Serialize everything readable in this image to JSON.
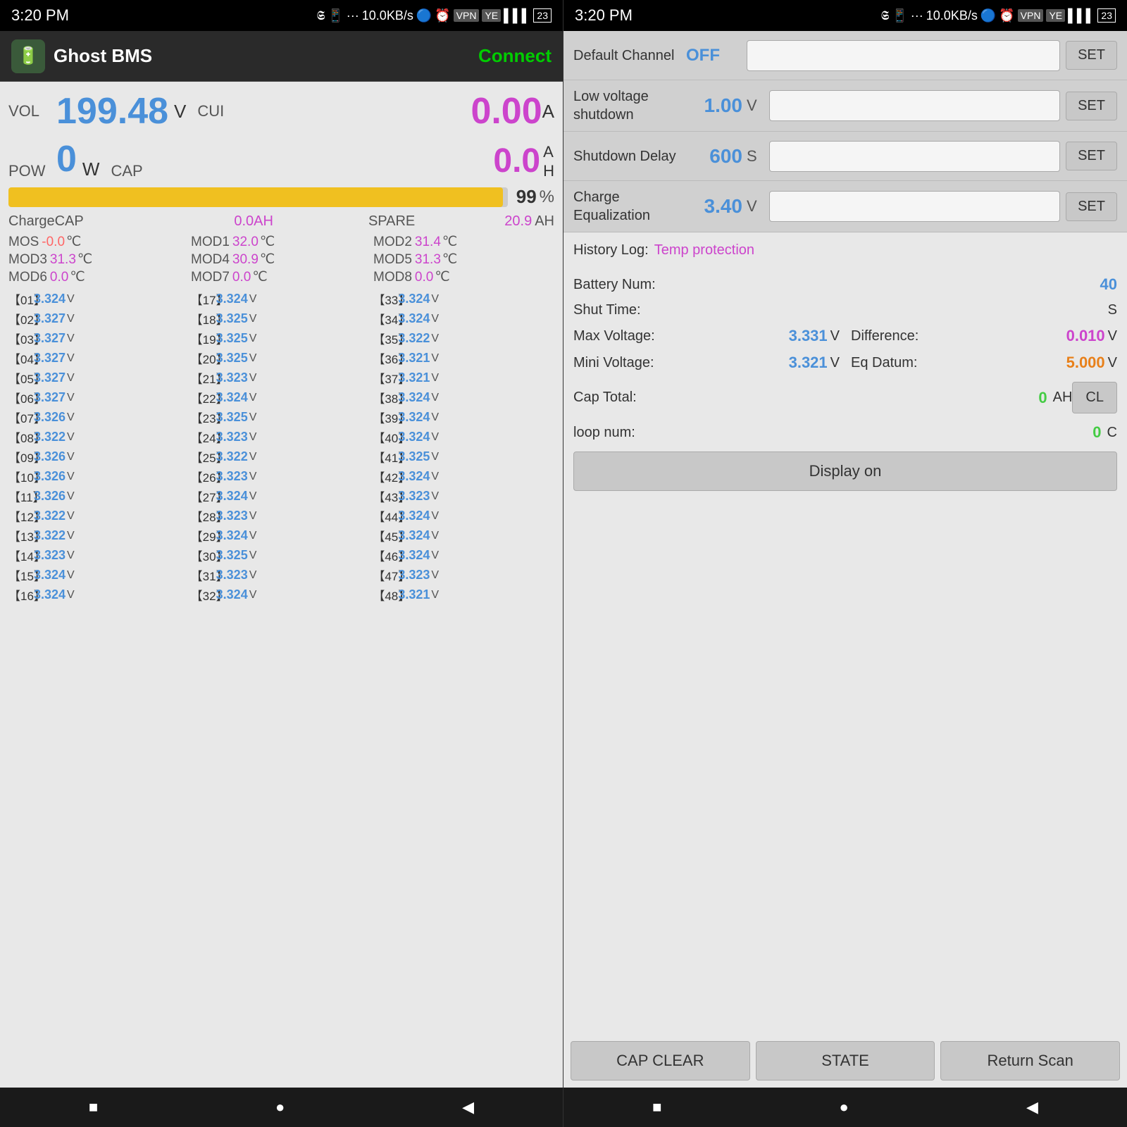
{
  "left": {
    "statusBar": {
      "time": "3:20 PM",
      "network": "10.0KB/s",
      "battery": "23"
    },
    "header": {
      "title": "Ghost BMS",
      "connectLabel": "Connect"
    },
    "voltage": {
      "label": "VOL",
      "value": "199.48",
      "unit": "V",
      "subLabel": "CUI",
      "currentValue": "0.00",
      "currentUnit": "A"
    },
    "power": {
      "label": "POW",
      "value": "0",
      "unit": "W",
      "capLabel": "CAP",
      "capValue": "0.0",
      "capUnitTop": "A",
      "capUnitBottom": "H"
    },
    "progress": {
      "percent": 99,
      "display": "99",
      "symbol": "%"
    },
    "chargeCap": {
      "label": "ChargeCAP",
      "value": "0.0AH",
      "spareLabel": "SPARE",
      "spareValue": "20.9",
      "spareUnit": "AH"
    },
    "mods": [
      {
        "name": "MOS",
        "value": "-0.0",
        "unit": "℃",
        "negative": true
      },
      {
        "name": "MOD1",
        "value": "32.0",
        "unit": "℃",
        "negative": false
      },
      {
        "name": "MOD2",
        "value": "31.4",
        "unit": "℃",
        "negative": false
      },
      {
        "name": "MOD3",
        "value": "31.3",
        "unit": "℃",
        "negative": false
      },
      {
        "name": "MOD4",
        "value": "30.9",
        "unit": "℃",
        "negative": false
      },
      {
        "name": "MOD5",
        "value": "31.3",
        "unit": "℃",
        "negative": false
      },
      {
        "name": "MOD6",
        "value": "0.0",
        "unit": "℃",
        "negative": false
      },
      {
        "name": "MOD7",
        "value": "0.0",
        "unit": "℃",
        "negative": false
      },
      {
        "name": "MOD8",
        "value": "0.0",
        "unit": "℃",
        "negative": false
      }
    ],
    "cells": [
      {
        "num": "【01】",
        "val": "3.324"
      },
      {
        "num": "【02】",
        "val": "3.327"
      },
      {
        "num": "【03】",
        "val": "3.327"
      },
      {
        "num": "【04】",
        "val": "3.327"
      },
      {
        "num": "【05】",
        "val": "3.327"
      },
      {
        "num": "【06】",
        "val": "3.327"
      },
      {
        "num": "【07】",
        "val": "3.326"
      },
      {
        "num": "【08】",
        "val": "3.322"
      },
      {
        "num": "【09】",
        "val": "3.326"
      },
      {
        "num": "【10】",
        "val": "3.326"
      },
      {
        "num": "【11】",
        "val": "3.326"
      },
      {
        "num": "【12】",
        "val": "3.322"
      },
      {
        "num": "【13】",
        "val": "3.322"
      },
      {
        "num": "【14】",
        "val": "3.323"
      },
      {
        "num": "【15】",
        "val": "3.324"
      },
      {
        "num": "【16】",
        "val": "3.324"
      },
      {
        "num": "【17】",
        "val": "3.324"
      },
      {
        "num": "【18】",
        "val": "3.325"
      },
      {
        "num": "【19】",
        "val": "3.325"
      },
      {
        "num": "【20】",
        "val": "3.325"
      },
      {
        "num": "【21】",
        "val": "3.323"
      },
      {
        "num": "【22】",
        "val": "3.324"
      },
      {
        "num": "【23】",
        "val": "3.325"
      },
      {
        "num": "【24】",
        "val": "3.323"
      },
      {
        "num": "【25】",
        "val": "3.322"
      },
      {
        "num": "【26】",
        "val": "3.323"
      },
      {
        "num": "【27】",
        "val": "3.324"
      },
      {
        "num": "【28】",
        "val": "3.323"
      },
      {
        "num": "【29】",
        "val": "3.324"
      },
      {
        "num": "【30】",
        "val": "3.325"
      },
      {
        "num": "【31】",
        "val": "3.323"
      },
      {
        "num": "【32】",
        "val": "3.324"
      },
      {
        "num": "【33】",
        "val": "3.324"
      },
      {
        "num": "【34】",
        "val": "3.324"
      },
      {
        "num": "【35】",
        "val": "3.322"
      },
      {
        "num": "【36】",
        "val": "3.321"
      },
      {
        "num": "【37】",
        "val": "3.321"
      },
      {
        "num": "【38】",
        "val": "3.324"
      },
      {
        "num": "【39】",
        "val": "3.324"
      },
      {
        "num": "【40】",
        "val": "3.324"
      },
      {
        "num": "【41】",
        "val": "3.325"
      },
      {
        "num": "【42】",
        "val": "3.324"
      },
      {
        "num": "【43】",
        "val": "3.323"
      },
      {
        "num": "【44】",
        "val": "3.324"
      },
      {
        "num": "【45】",
        "val": "3.324"
      },
      {
        "num": "【46】",
        "val": "3.324"
      },
      {
        "num": "【47】",
        "val": "3.323"
      },
      {
        "num": "【48】",
        "val": "3.321"
      }
    ],
    "nav": {
      "stop": "■",
      "home": "●",
      "back": "◀"
    }
  },
  "right": {
    "statusBar": {
      "time": "3:20 PM",
      "network": "10.0KB/s",
      "battery": "23"
    },
    "settings": [
      {
        "name": "Default Channel",
        "value": "OFF",
        "unit": "",
        "setLabel": "SET",
        "valueColor": "blue"
      },
      {
        "name": "Low voltage shutdown",
        "value": "1.00",
        "unit": "V",
        "setLabel": "SET",
        "valueColor": "blue"
      },
      {
        "name": "Shutdown Delay",
        "value": "600",
        "unit": "S",
        "setLabel": "SET",
        "valueColor": "blue"
      },
      {
        "name": "Charge Equalization",
        "value": "3.40",
        "unit": "V",
        "setLabel": "SET",
        "valueColor": "blue"
      }
    ],
    "history": {
      "label": "History  Log:",
      "tempLabel": "Temp protection"
    },
    "batteryNum": {
      "label": "Battery Num:",
      "value": "40"
    },
    "shutTime": {
      "label": "Shut   Time:",
      "unit": "S"
    },
    "maxVoltage": {
      "label": "Max Voltage:",
      "value": "3.331",
      "unit": "V",
      "diffLabel": "Difference:",
      "diffValue": "0.010",
      "diffUnit": "V"
    },
    "miniVoltage": {
      "label": "Mini Voltage:",
      "value": "3.321",
      "unit": "V",
      "eqLabel": "Eq Datum:",
      "eqValue": "5.000",
      "eqUnit": "V"
    },
    "capTotal": {
      "label": "Cap   Total:",
      "value": "0",
      "unit": "AH",
      "clLabel": "CL"
    },
    "loopNum": {
      "label": "loop   num:",
      "value": "0",
      "unit": "C"
    },
    "displayOnLabel": "Display on",
    "bottomBtns": {
      "capClear": "CAP CLEAR",
      "state": "STATE",
      "returnScan": "Return Scan"
    },
    "nav": {
      "stop": "■",
      "home": "●",
      "back": "◀"
    }
  }
}
